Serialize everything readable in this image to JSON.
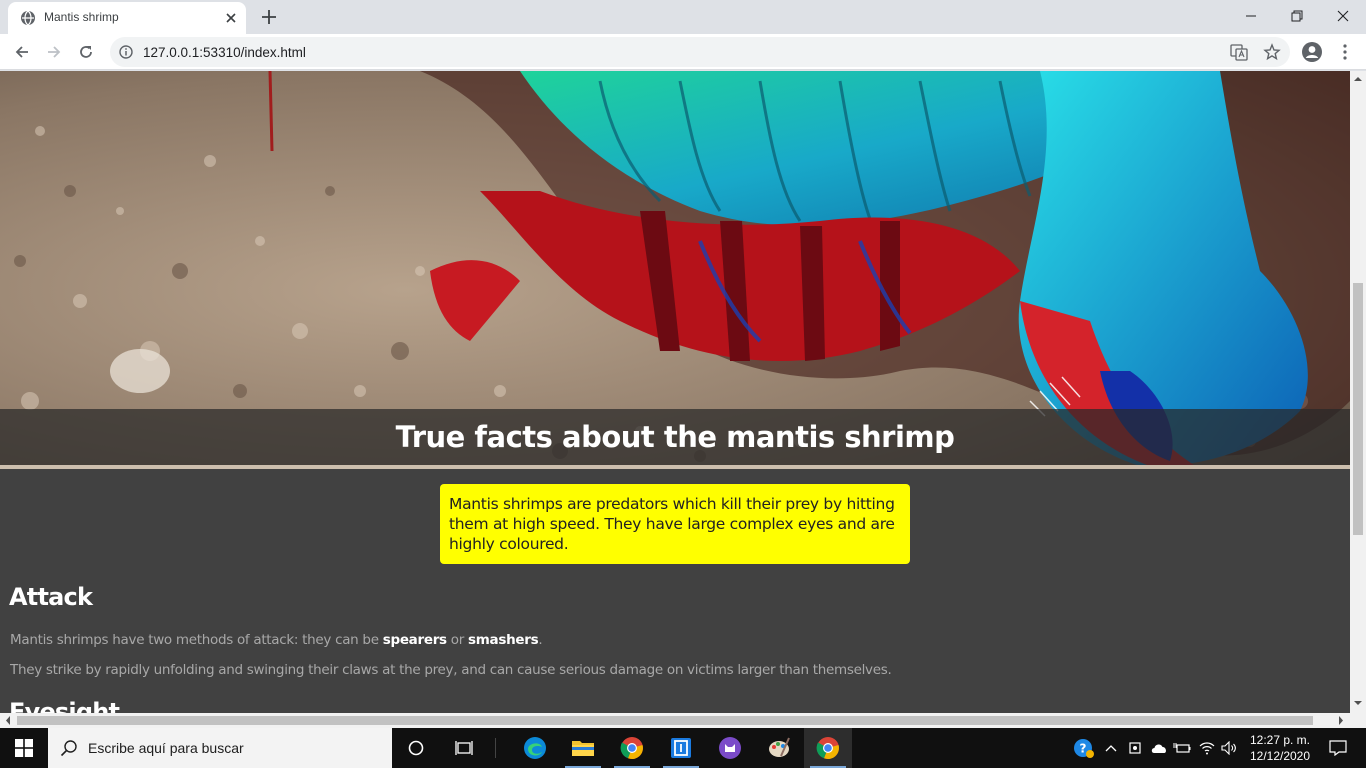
{
  "browser": {
    "tab_title": "Mantis shrimp",
    "url": "127.0.0.1:53310/index.html"
  },
  "page": {
    "banner_title": "True facts about the mantis shrimp",
    "intro": "Mantis shrimps are predators which kill their prey by hitting them at high speed. They have large complex eyes and are highly coloured.",
    "attack": {
      "heading": "Attack",
      "p1_before": "Mantis shrimps have two methods of attack: they can be",
      "p1_term1": "spearers",
      "p1_mid": "or",
      "p1_term2": "smashers",
      "p1_after": ".",
      "p2": "They strike by rapidly unfolding and swinging their claws at the prey, and can cause serious damage on victims larger than themselves."
    },
    "next_heading": "Eyesight"
  },
  "taskbar": {
    "search_placeholder": "Escribe aquí para buscar",
    "time": "12:27 p. m.",
    "date": "12/12/2020"
  },
  "colors": {
    "page_background": "#414141",
    "highlight": "#ffff00",
    "heading": "#ffffff",
    "body_text": "#a8a8a8"
  }
}
